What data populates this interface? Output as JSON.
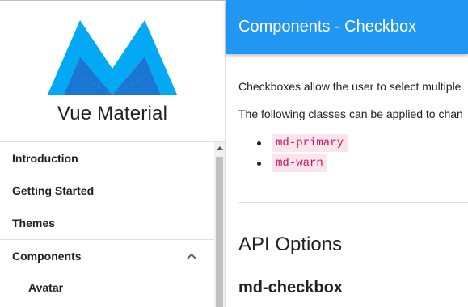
{
  "brand": {
    "title": "Vue Material",
    "logo_icon": "vue-material-logo-icon",
    "logo_colors": {
      "light": "#03a9f4",
      "dark": "#1976d2"
    }
  },
  "sidebar": {
    "items": [
      {
        "label": "Introduction"
      },
      {
        "label": "Getting Started"
      },
      {
        "label": "Themes"
      },
      {
        "label": "Components",
        "expanded": true,
        "icon": "chevron-up-icon"
      },
      {
        "label": "Avatar"
      }
    ]
  },
  "header": {
    "title": "Components - Checkbox",
    "color": "#2196f3"
  },
  "main": {
    "intro": "Checkboxes allow the user to select multiple",
    "classes_text": "The following classes can be applied to chan",
    "classes": [
      "md-primary",
      "md-warn"
    ],
    "api_heading": "API Options",
    "component_heading": "md-checkbox"
  }
}
